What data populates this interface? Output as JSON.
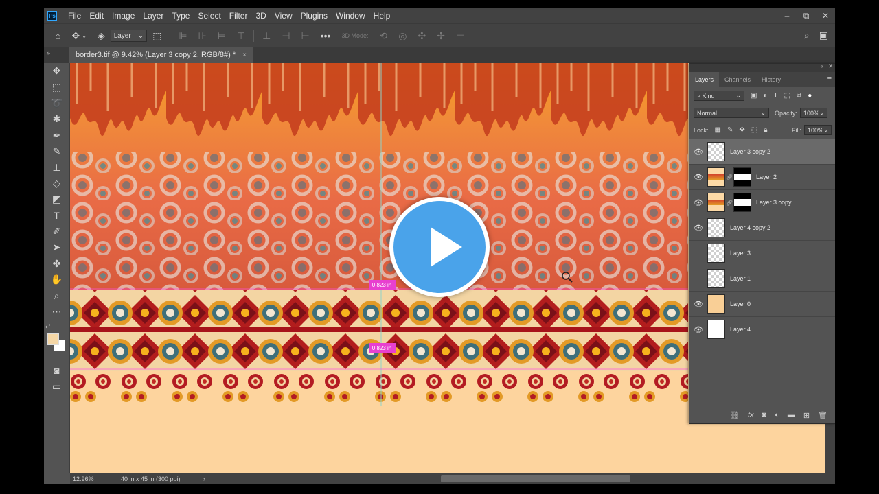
{
  "app": {
    "logo": "Ps"
  },
  "menu": [
    "File",
    "Edit",
    "Image",
    "Layer",
    "Type",
    "Select",
    "Filter",
    "3D",
    "View",
    "Plugins",
    "Window",
    "Help"
  ],
  "window_controls": {
    "minimize": "–",
    "restore": "⧉",
    "close": "✕"
  },
  "options": {
    "auto_select_target": "Layer",
    "three_d_mode": "3D Mode:"
  },
  "document": {
    "tab_title": "border3.tif @ 9.42% (Layer 3 copy 2, RGB/8#) *",
    "close": "×"
  },
  "canvas": {
    "guide_label_1": "0.823 in",
    "guide_label_2": "0.823 in"
  },
  "status": {
    "zoom": "12.96%",
    "doc_info": "40 in x 45 in (300 ppi)",
    "arrow": "›"
  },
  "layers_panel": {
    "tabs": [
      "Layers",
      "Channels",
      "History"
    ],
    "filter_kind": "Kind",
    "blend_mode": "Normal",
    "opacity_label": "Opacity:",
    "opacity_value": "100%",
    "lock_label": "Lock:",
    "fill_label": "Fill:",
    "fill_value": "100%",
    "layers": [
      {
        "name": "Layer 3 copy 2",
        "visible": true,
        "selected": true,
        "thumb": "transparent-art",
        "mask": false
      },
      {
        "name": "Layer 2",
        "visible": true,
        "selected": false,
        "thumb": "art",
        "mask": true
      },
      {
        "name": "Layer 3 copy",
        "visible": true,
        "selected": false,
        "thumb": "art",
        "mask": true
      },
      {
        "name": "Layer 4 copy 2",
        "visible": true,
        "selected": false,
        "thumb": "transparent",
        "mask": false
      },
      {
        "name": "Layer 3",
        "visible": false,
        "selected": false,
        "thumb": "transparent",
        "mask": false
      },
      {
        "name": "Layer 1",
        "visible": false,
        "selected": false,
        "thumb": "transparent",
        "mask": false
      },
      {
        "name": "Layer 0",
        "visible": true,
        "selected": false,
        "thumb": "cream",
        "mask": false
      },
      {
        "name": "Layer 4",
        "visible": true,
        "selected": false,
        "thumb": "white",
        "mask": false
      }
    ]
  },
  "colors": {
    "foreground": "#f5d7a6",
    "background": "#ffffff",
    "play_button": "#4aa3ea",
    "accent_ps": "#31a8ff"
  },
  "icons": {
    "play": "play-icon",
    "eye": "eye-icon",
    "move": "move-tool-icon",
    "search": "search-icon"
  }
}
